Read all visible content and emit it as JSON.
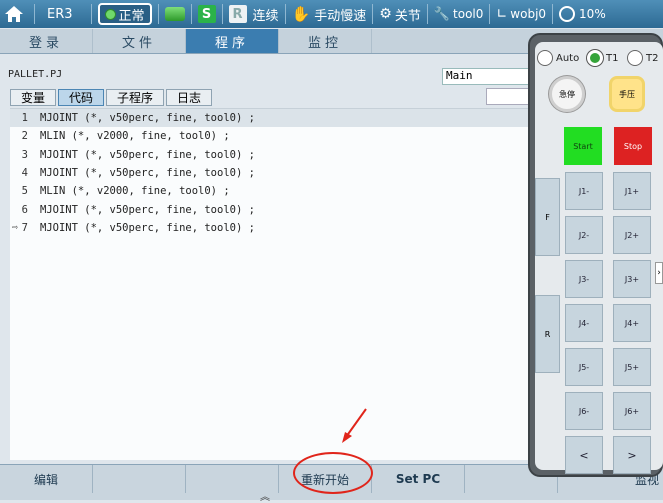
{
  "topbar": {
    "robot": "ER3",
    "status": "正常",
    "s_badge": "S",
    "r_badge": "R",
    "mode": "连续",
    "speed_mode": "手动慢速",
    "joint_label": "关节",
    "tool": "tool0",
    "wobj": "wobj0",
    "speed_pct": "10%"
  },
  "nav": {
    "tabs": [
      {
        "label": "登录"
      },
      {
        "label": "文件"
      },
      {
        "label": "程序"
      },
      {
        "label": "监控"
      }
    ]
  },
  "file": {
    "name": "PALLET.PJ",
    "routine": "Main"
  },
  "subtabs": [
    {
      "label": "变量"
    },
    {
      "label": "代码"
    },
    {
      "label": "子程序"
    },
    {
      "label": "日志"
    }
  ],
  "code": {
    "lines": [
      {
        "num": "1",
        "text": "MJOINT (*, v50perc, fine, tool0) ;"
      },
      {
        "num": "2",
        "text": "MLIN (*, v2000, fine, tool0) ;"
      },
      {
        "num": "3",
        "text": "MJOINT (*, v50perc, fine, tool0) ;"
      },
      {
        "num": "4",
        "text": "MJOINT (*, v50perc, fine, tool0) ;"
      },
      {
        "num": "5",
        "text": "MLIN (*, v2000, fine, tool0) ;"
      },
      {
        "num": "6",
        "text": "MJOINT (*, v50perc, fine, tool0) ;"
      },
      {
        "num": "7",
        "text": "MJOINT (*, v50perc, fine, tool0) ;"
      }
    ],
    "pointer_symbol": "⇨"
  },
  "bottom": {
    "edit": "编辑",
    "restart": "重新开始",
    "setpc": "Set PC",
    "monitor": "监视"
  },
  "panel": {
    "auto": "Auto",
    "t1": "T1",
    "t2": "T2",
    "estop": "急停",
    "handpress": "手压",
    "start": "Start",
    "stop": "Stop",
    "f": "F",
    "r": "R",
    "joints": [
      {
        "minus": "J1-",
        "plus": "J1+"
      },
      {
        "minus": "J2-",
        "plus": "J2+"
      },
      {
        "minus": "J3-",
        "plus": "J3+"
      },
      {
        "minus": "J4-",
        "plus": "J4+"
      },
      {
        "minus": "J5-",
        "plus": "J5+"
      },
      {
        "minus": "J6-",
        "plus": "J6+"
      }
    ],
    "prev": "<",
    "next": ">"
  },
  "colors": {
    "accent": "#3b7db0",
    "start_green": "#22dd22",
    "stop_red": "#dd2222",
    "annotation_red": "#e0251b"
  }
}
